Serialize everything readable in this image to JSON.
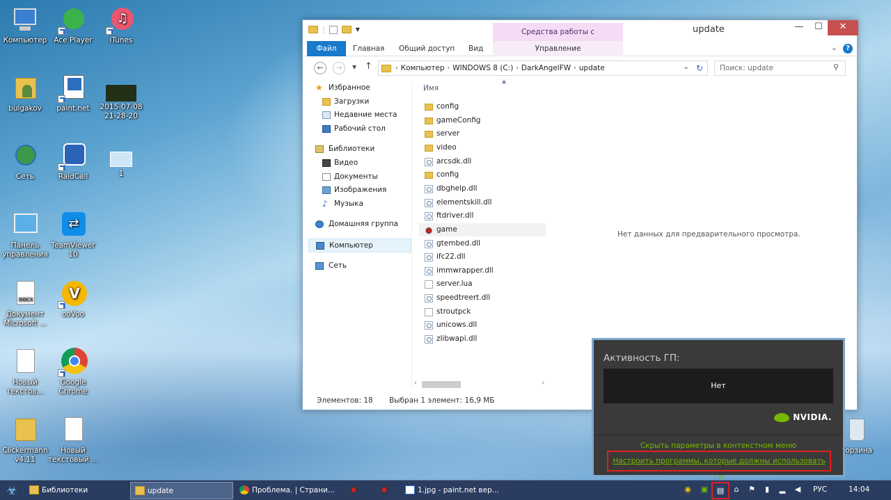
{
  "desktop": {
    "icons": [
      {
        "label": "Компьютер"
      },
      {
        "label": "Ace Player"
      },
      {
        "label": "iTunes"
      },
      {
        "label": "bulgakov"
      },
      {
        "label": "paint.net"
      },
      {
        "label": "2015-07-08 21-28-20"
      },
      {
        "label": "Сеть"
      },
      {
        "label": "RaidCall"
      },
      {
        "label": "1"
      },
      {
        "label": "Панель управления"
      },
      {
        "label": "TeamViewer 10"
      },
      {
        "label": "Документ Microsoft ..."
      },
      {
        "label": "ooVoo"
      },
      {
        "label": "Новый текстов..."
      },
      {
        "label": "Google Chrome"
      },
      {
        "label": "Clickermann v4.11"
      },
      {
        "label": "Новый текстовый ..."
      },
      {
        "label": "Корзина"
      }
    ]
  },
  "explorer": {
    "title": "update",
    "context_tab": "Средства работы с приложениями",
    "tabs": {
      "file": "Файл",
      "home": "Главная",
      "share": "Общий доступ",
      "view": "Вид",
      "manage": "Управление"
    },
    "breadcrumb": [
      "Компьютер",
      "WINDOWS 8 (C:)",
      "DarkAngelFW",
      "update"
    ],
    "search_placeholder": "Поиск: update",
    "nav": {
      "favorites": "Избранное",
      "downloads": "Загрузки",
      "recent": "Недавние места",
      "desktop": "Рабочий стол",
      "libraries": "Библиотеки",
      "video": "Видео",
      "documents": "Документы",
      "images": "Изображения",
      "music": "Музыка",
      "homegroup": "Домашняя группа",
      "computer": "Компьютер",
      "network": "Сеть"
    },
    "column_name": "Имя",
    "files": [
      {
        "name": "config",
        "type": "folder"
      },
      {
        "name": "gameConfig",
        "type": "folder"
      },
      {
        "name": "server",
        "type": "folder"
      },
      {
        "name": "video",
        "type": "folder"
      },
      {
        "name": "arcsdk.dll",
        "type": "dll"
      },
      {
        "name": "config",
        "type": "folder"
      },
      {
        "name": "dbghelp.dll",
        "type": "dll"
      },
      {
        "name": "elementskill.dll",
        "type": "dll"
      },
      {
        "name": "ftdriver.dll",
        "type": "dll"
      },
      {
        "name": "game",
        "type": "exe"
      },
      {
        "name": "gtembed.dll",
        "type": "dll"
      },
      {
        "name": "ifc22.dll",
        "type": "dll"
      },
      {
        "name": "immwrapper.dll",
        "type": "dll"
      },
      {
        "name": "server.lua",
        "type": "file"
      },
      {
        "name": "speedtreert.dll",
        "type": "dll"
      },
      {
        "name": "stroutpck",
        "type": "file"
      },
      {
        "name": "unicows.dll",
        "type": "dll"
      },
      {
        "name": "zlibwapi.dll",
        "type": "dll"
      }
    ],
    "preview_text": "Нет данных для предварительного просмотра.",
    "status_count": "Элементов: 18",
    "status_selected": "Выбран 1 элемент: 16,9 МБ"
  },
  "nvidia": {
    "title": "Активность ГП:",
    "box_text": "Нет",
    "logo": "NVIDIA.",
    "hide_link": "Скрыть параметры в контекстном меню",
    "config_link": "Настроить программы, которые должны использовать ГП"
  },
  "taskbar": {
    "items": [
      {
        "label": "Библиотеки"
      },
      {
        "label": "update"
      },
      {
        "label": "Проблема. | Страни..."
      },
      {
        "label": "1.jpg - paint.net вер..."
      }
    ],
    "lang": "РУС",
    "time": "14:04"
  }
}
